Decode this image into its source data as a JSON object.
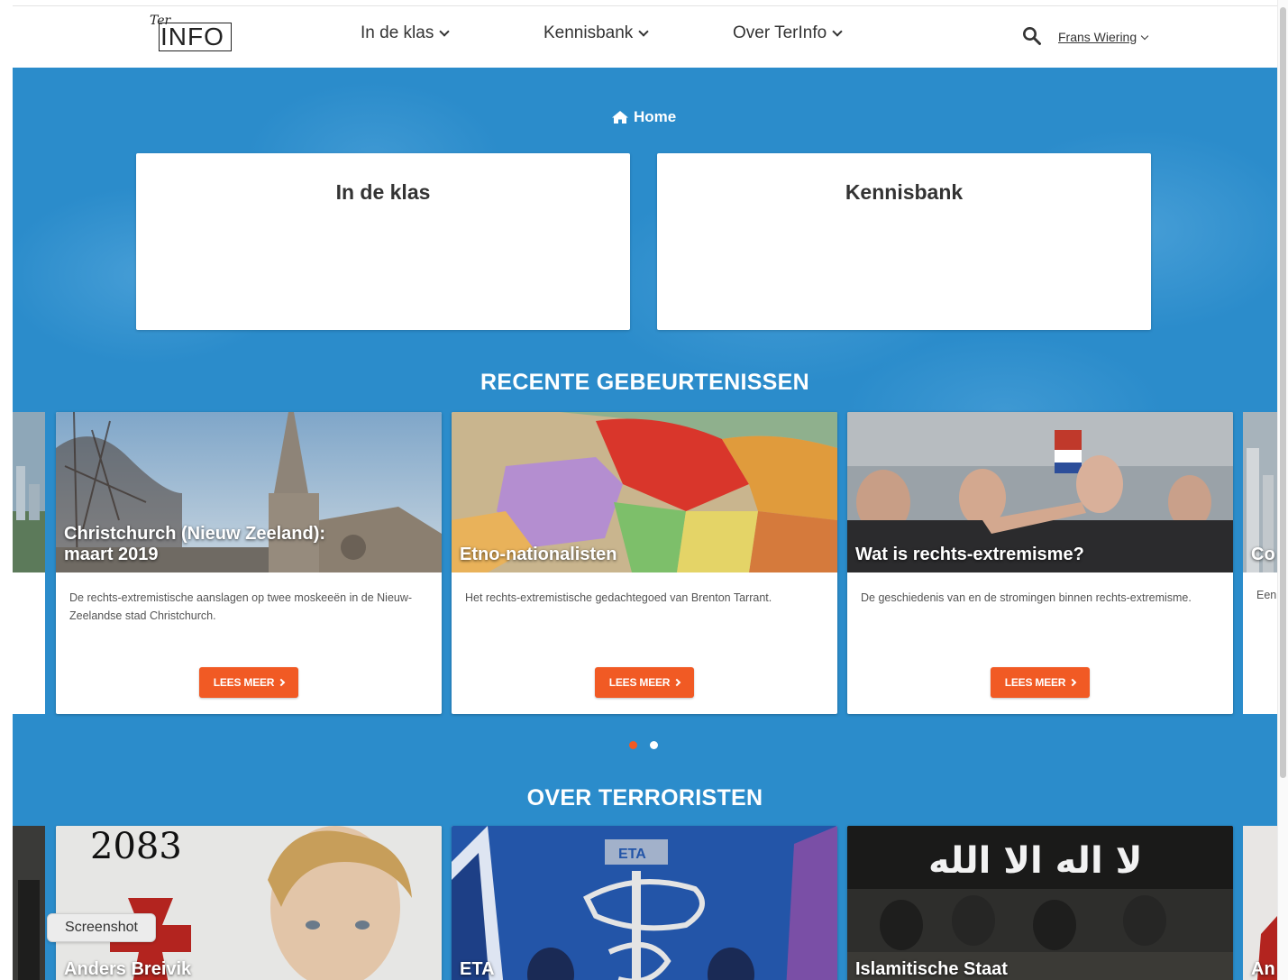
{
  "header": {
    "logo_script": "Ter",
    "logo_text": "INFO",
    "nav": [
      {
        "label": "In de klas"
      },
      {
        "label": "Kennisbank"
      },
      {
        "label": "Over TerInfo"
      }
    ],
    "user": "Frans Wiering"
  },
  "breadcrumb": {
    "label": "Home"
  },
  "tiles": [
    {
      "title": "In de klas"
    },
    {
      "title": "Kennisbank"
    }
  ],
  "recent": {
    "title": "RECENTE GEBEURTENISSEN",
    "cards": [
      {
        "title": "Christchurch (Nieuw Zeeland): maart 2019",
        "description": "De rechts-extremistische aanslagen op twee moskeeën in de Nieuw-Zeelandse stad Christchurch.",
        "button": "LEES MEER"
      },
      {
        "title": "Etno-nationalisten",
        "description": "Het rechts-extremistische gedachtegoed van Brenton Tarrant.",
        "button": "LEES MEER"
      },
      {
        "title": "Wat is rechts-extremisme?",
        "description": "De geschiedenis van en de stromingen binnen rechts-extremisme.",
        "button": "LEES MEER"
      }
    ],
    "peek_right": {
      "title": "Co",
      "description": "Een"
    },
    "active_dot": 1,
    "dot_count": 2
  },
  "terrorists": {
    "title": "OVER TERRORISTEN",
    "cards": [
      {
        "title": "Anders Breivik",
        "image_text": "2083"
      },
      {
        "title": "ETA",
        "image_text": "ETA"
      },
      {
        "title": "Islamitische Staat",
        "image_text": "لا اله الا الله"
      }
    ],
    "peek_right": {
      "title": "An"
    }
  },
  "tooltip": "Screenshot",
  "colors": {
    "hero_blue": "#2b8ccb",
    "accent_orange": "#f15a24",
    "dot_inactive": "#ffffff"
  }
}
